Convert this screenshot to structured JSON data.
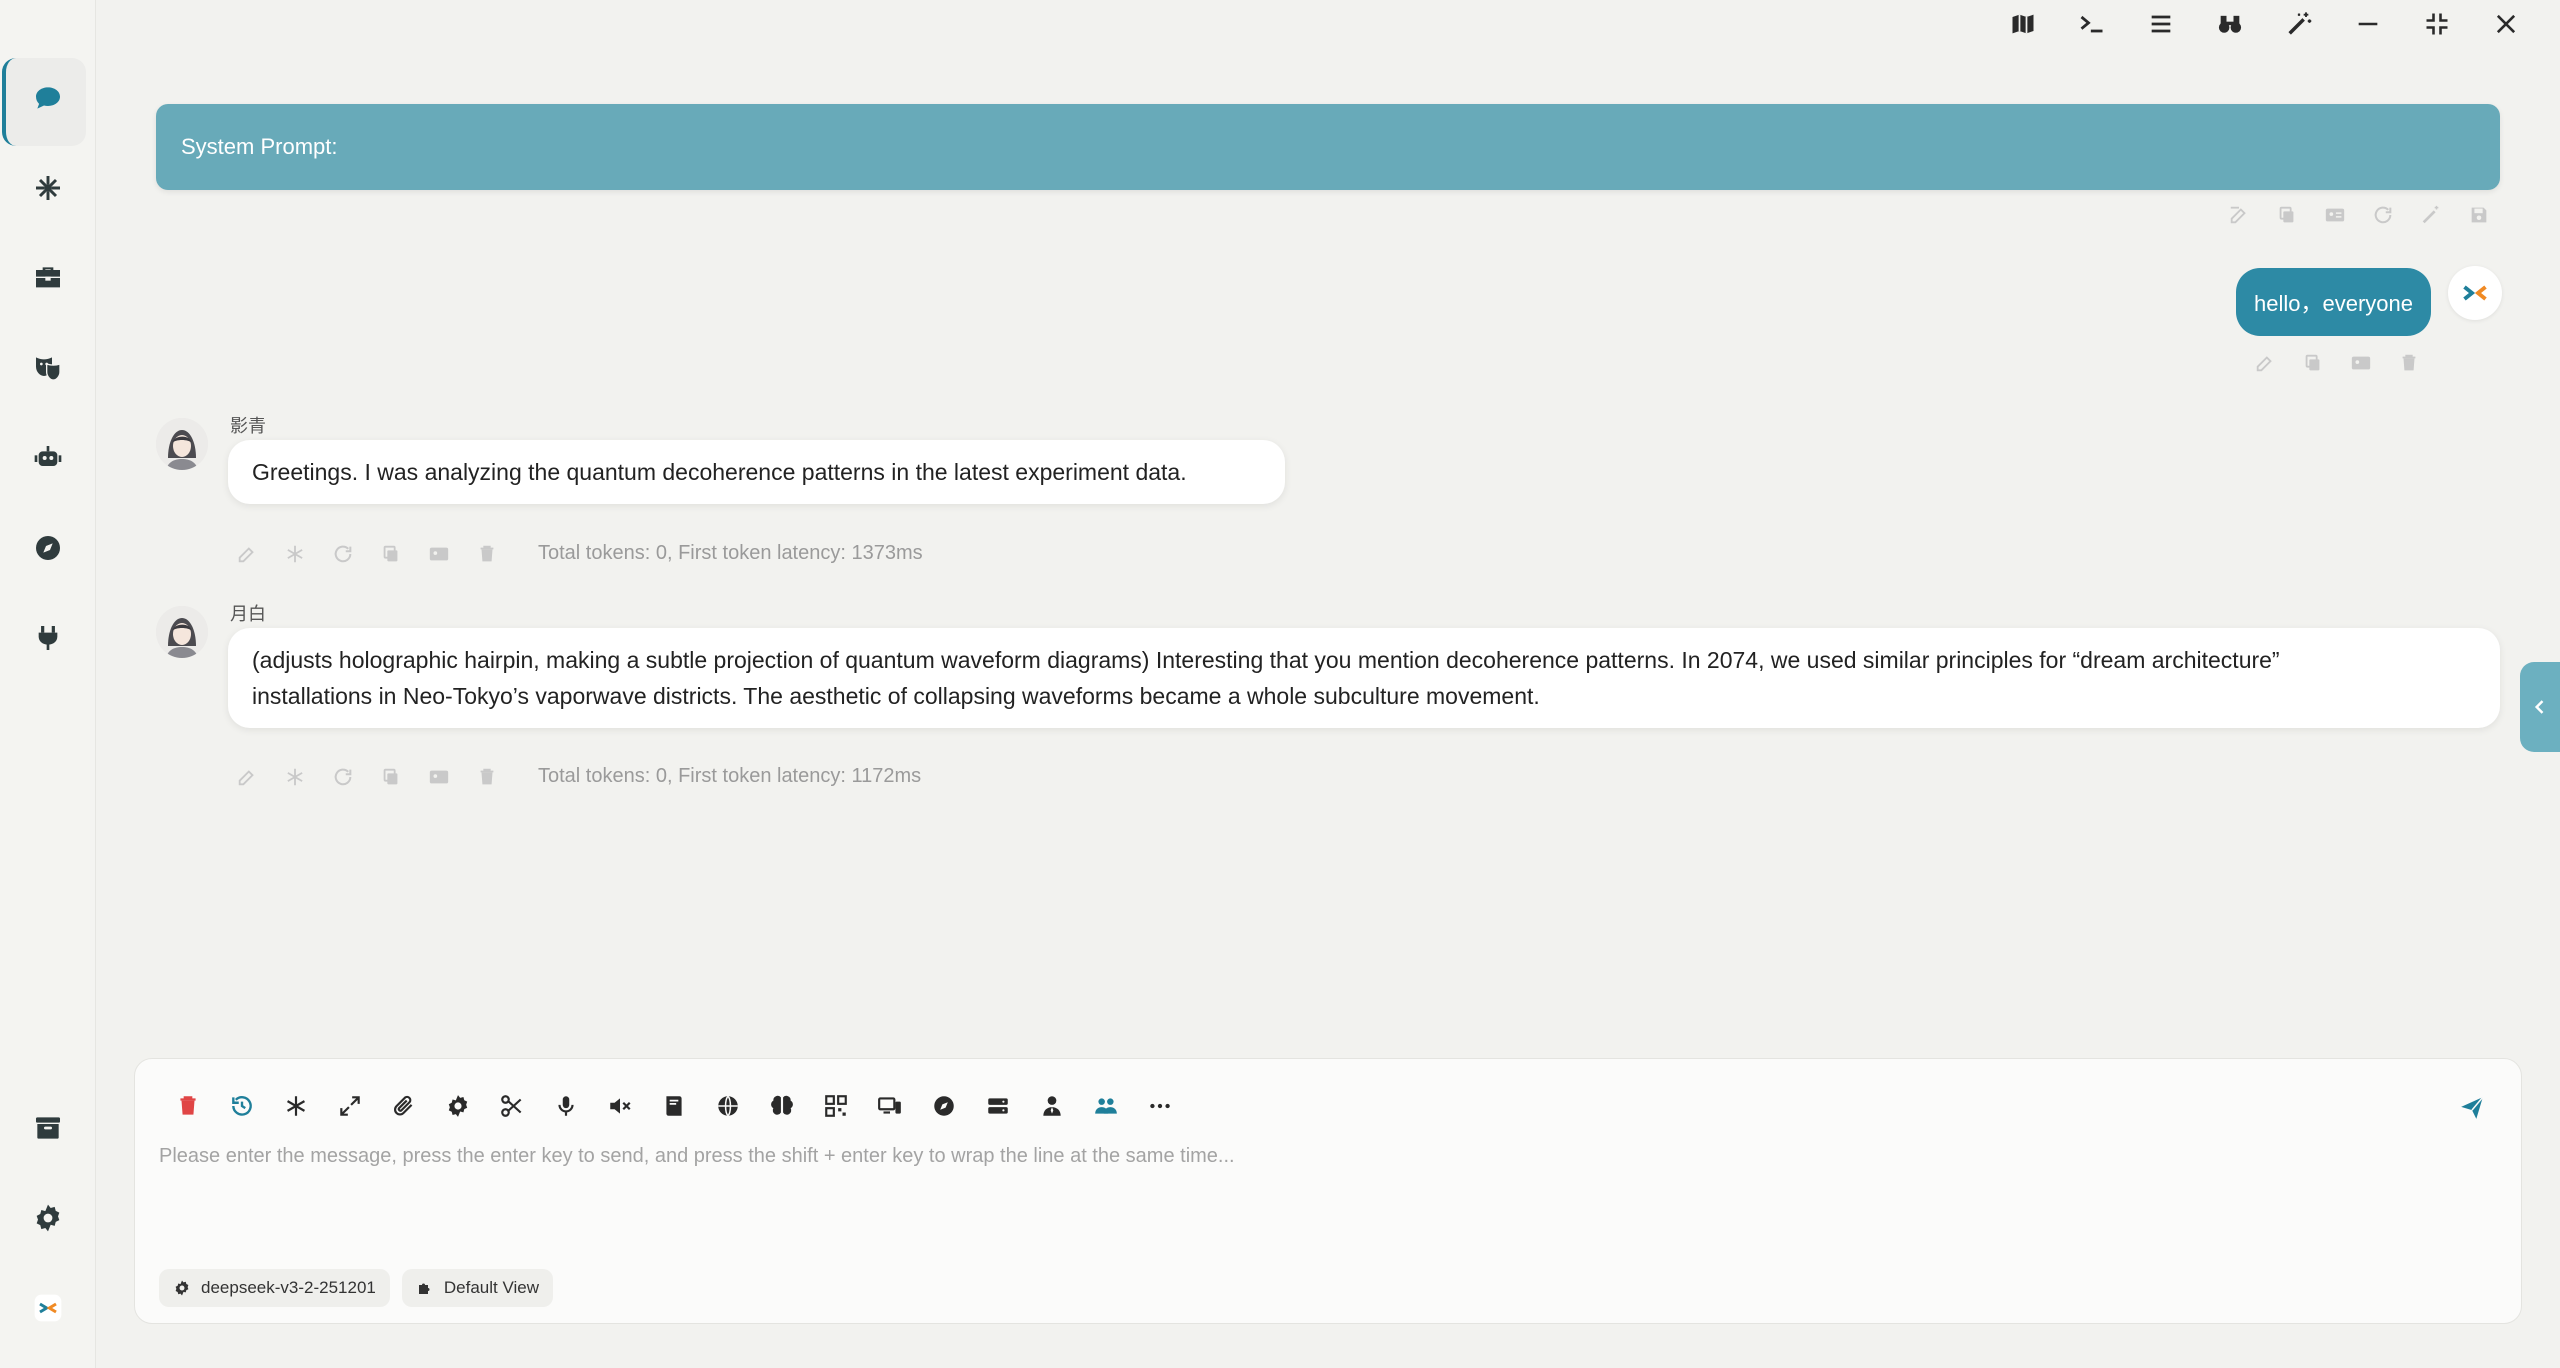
{
  "colors": {
    "accent": "#1f7f9a",
    "system_bar": "#68aab9",
    "user_bubble": "#2d8aa5",
    "danger": "#e04545"
  },
  "sidebar": {
    "items": [
      {
        "icon": "chat-bubble-icon",
        "active": true
      },
      {
        "icon": "network-icon"
      },
      {
        "icon": "toolbox-icon"
      },
      {
        "icon": "theater-masks-icon"
      },
      {
        "icon": "robot-icon"
      },
      {
        "icon": "compass-icon"
      },
      {
        "icon": "plug-icon"
      }
    ],
    "bottom_items": [
      {
        "icon": "archive-icon"
      },
      {
        "icon": "settings-gear-icon"
      },
      {
        "icon": "app-logo-icon"
      }
    ]
  },
  "titlebar": {
    "icons": [
      "map-icon",
      "terminal-icon",
      "menu-icon",
      "binoculars-icon",
      "magic-wand-icon",
      "minimize-icon",
      "restore-icon",
      "close-icon"
    ]
  },
  "system": {
    "label": "System Prompt:"
  },
  "messages": [
    {
      "role": "user",
      "text": "hello，everyone"
    },
    {
      "role": "assistant",
      "name": "影青",
      "text": "Greetings. I was analyzing the quantum decoherence patterns in the latest experiment data.",
      "stats": "Total tokens: 0, First token latency: 1373ms"
    },
    {
      "role": "assistant",
      "name": "月白",
      "text_line1": "(adjusts holographic hairpin, making a subtle projection of quantum waveform diagrams) Interesting that you mention decoherence patterns. In 2074, we used similar principles for “dream architecture”",
      "text_line2": "installations in Neo-Tokyo’s vaporwave districts. The aesthetic of collapsing waveforms became a whole subculture movement.",
      "stats": "Total tokens: 0, First token latency: 1172ms"
    }
  ],
  "composer": {
    "placeholder": "Please enter the message, press the enter key to send, and press the shift + enter key to wrap the line at the same time...",
    "model": "deepseek-v3-2-251201",
    "view": "Default View",
    "tools": [
      "trash-icon",
      "history-icon",
      "asterisk-icon",
      "expand-icon",
      "paperclip-icon",
      "cog-icon",
      "scissors-icon",
      "microphone-icon",
      "mute-icon",
      "book-icon",
      "globe-icon",
      "brain-icon",
      "qrcode-icon",
      "devices-icon",
      "compass-icon",
      "server-icon",
      "user-tie-icon",
      "users-icon",
      "more-icon"
    ]
  }
}
